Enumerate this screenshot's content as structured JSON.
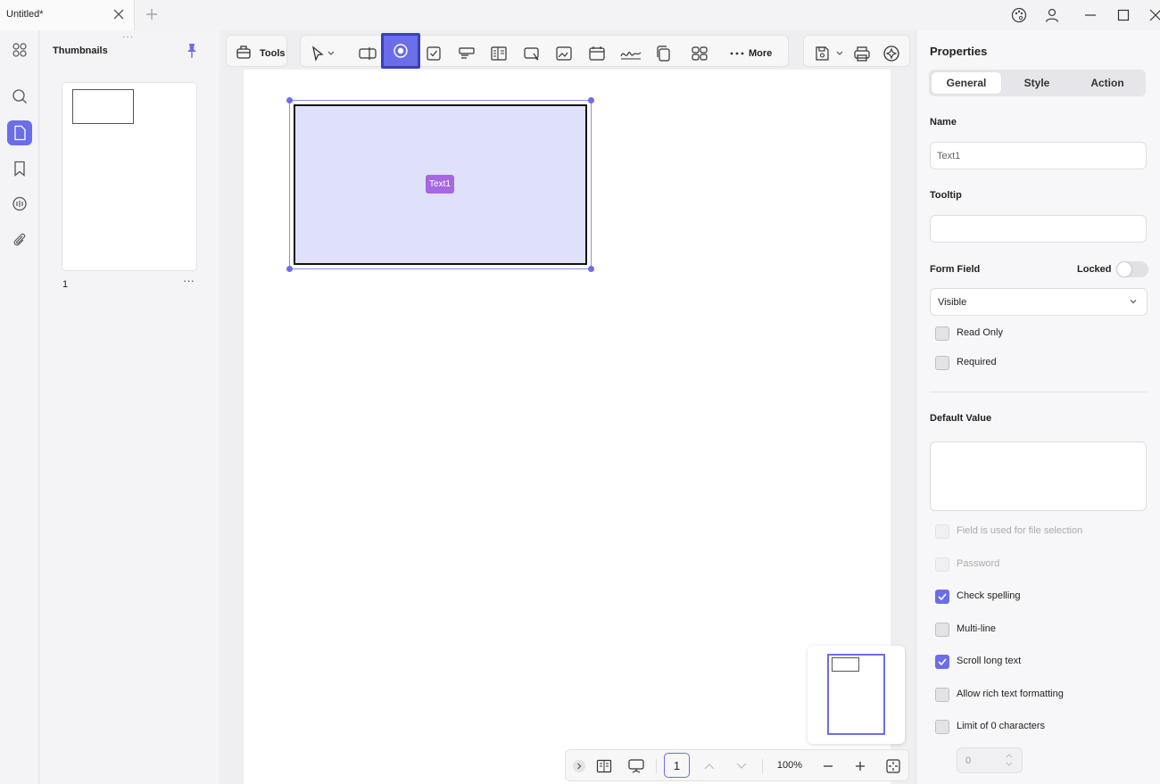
{
  "window": {
    "tab_title": "Untitled*"
  },
  "thumbnails": {
    "title": "Thumbnails",
    "grip": "···",
    "page_number": "1",
    "more": "···"
  },
  "toolbar": {
    "tools_label": "Tools",
    "more_label": "More"
  },
  "canvas": {
    "field_name_tag": "Text1"
  },
  "bottom_bar": {
    "current_page": "1",
    "zoom": "100%"
  },
  "properties": {
    "title": "Properties",
    "tabs": [
      {
        "label": "General",
        "active": true
      },
      {
        "label": "Style",
        "active": false
      },
      {
        "label": "Action",
        "active": false
      }
    ],
    "name_label": "Name",
    "name_value": "Text1",
    "tooltip_label": "Tooltip",
    "tooltip_value": "",
    "form_field_label": "Form Field",
    "locked_label": "Locked",
    "locked": false,
    "visibility_value": "Visible",
    "read_only_label": "Read Only",
    "read_only": false,
    "required_label": "Required",
    "required": false,
    "default_value_label": "Default Value",
    "default_value": "",
    "options": [
      {
        "label": "Field is used for file selection",
        "checked": false,
        "disabled": true
      },
      {
        "label": "Password",
        "checked": false,
        "disabled": true
      },
      {
        "label": "Check spelling",
        "checked": true,
        "disabled": false
      },
      {
        "label": "Multi-line",
        "checked": false,
        "disabled": false
      },
      {
        "label": "Scroll long text",
        "checked": true,
        "disabled": false
      },
      {
        "label": "Allow rich text formatting",
        "checked": false,
        "disabled": false
      },
      {
        "label": "Limit of 0 characters",
        "checked": false,
        "disabled": false
      }
    ],
    "char_limit_value": "0"
  },
  "colors": {
    "accent": "#6b6ee8",
    "field_fill": "#dfe0fa",
    "tag_purple": "#a668e0"
  }
}
